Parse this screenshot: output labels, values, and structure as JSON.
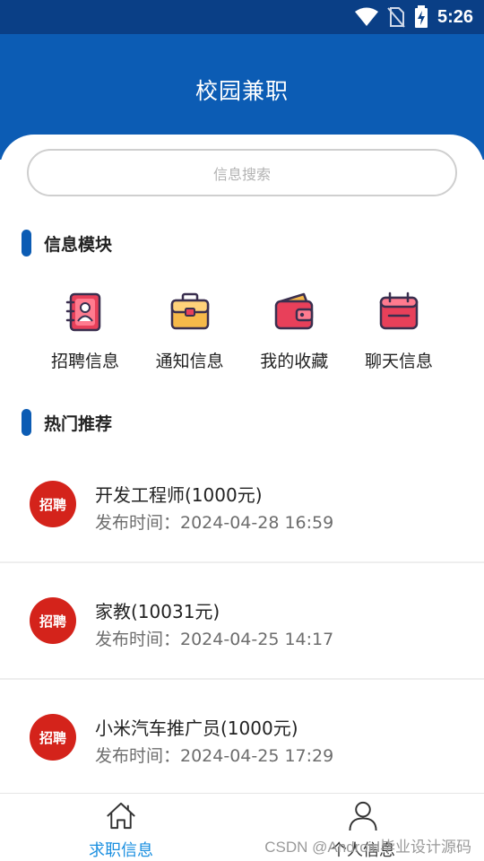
{
  "status_bar": {
    "time": "5:26"
  },
  "header": {
    "title": "校园兼职"
  },
  "search": {
    "placeholder": "信息搜索"
  },
  "modules_section": {
    "title": "信息模块",
    "items": [
      {
        "label": "招聘信息",
        "icon": "recruit-book-icon"
      },
      {
        "label": "通知信息",
        "icon": "briefcase-icon"
      },
      {
        "label": "我的收藏",
        "icon": "wallet-icon"
      },
      {
        "label": "聊天信息",
        "icon": "calendar-icon"
      }
    ]
  },
  "hot_section": {
    "title": "热门推荐",
    "items": [
      {
        "badge": "招聘",
        "title": "开发工程师(1000元)",
        "time": "发布时间：2024-04-28 16:59"
      },
      {
        "badge": "招聘",
        "title": "家教(10031元)",
        "time": "发布时间：2024-04-25 14:17"
      },
      {
        "badge": "招聘",
        "title": "小米汽车推广员(1000元)",
        "time": "发布时间：2024-04-25 17:29"
      }
    ]
  },
  "tabbar": {
    "tabs": [
      {
        "label": "求职信息",
        "icon": "home-icon",
        "active": true
      },
      {
        "label": "个人信息",
        "icon": "person-icon",
        "active": false
      }
    ]
  },
  "watermark": "CSDN @Android毕业设计源码",
  "colors": {
    "primary": "#0c5cb4",
    "status_bar": "#0a3f86",
    "badge": "#d4231b",
    "tab_active": "#1a8fe0"
  }
}
